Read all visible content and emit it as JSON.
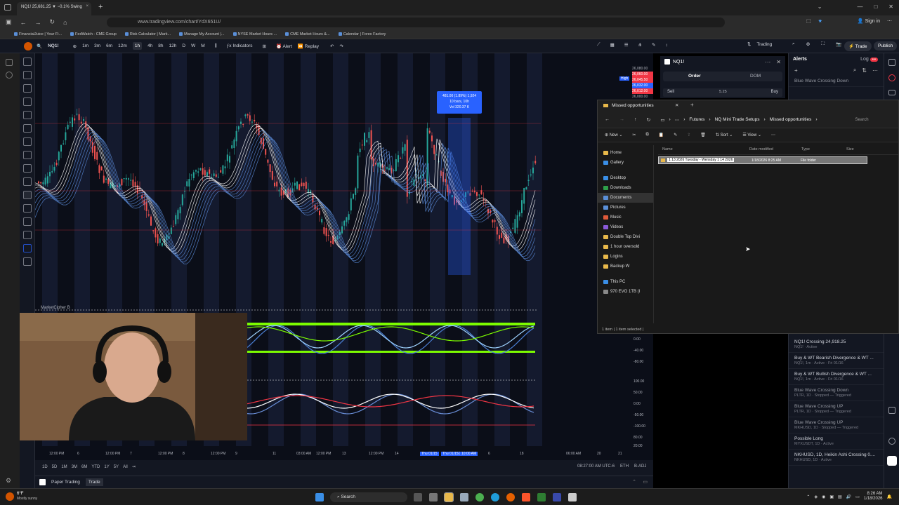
{
  "browser": {
    "tab_title": "NQ1! 25,681.25 ▼ −0.1% Swing",
    "url": "www.tradingview.com/chart/YdX651U/",
    "signin": "Sign in",
    "bookmarks": [
      "FinancialJuice | Your Fi...",
      "FedWatch - CME Group",
      "Risk Calculator | Mark...",
      "Manage My Account |...",
      "NYSE Market Hours ...",
      "CME Market Hours &...",
      "Calendar | Forex Factory"
    ]
  },
  "toolbar": {
    "symbol": "NQ1!",
    "intervals": [
      "1m",
      "3m",
      "6m",
      "12m",
      "1h",
      "4h",
      "8h",
      "12h",
      "D",
      "W",
      "M"
    ],
    "active_interval": "1h",
    "indicators": "Indicators",
    "alert": "Alert",
    "replay": "Replay",
    "trading": "Trading",
    "trade": "Trade",
    "publish": "Publish"
  },
  "chart": {
    "price_labels": [
      "26,080.00",
      "26,060.00",
      "26,045.50",
      "26,032.00",
      "26,012.00",
      "26,000.00"
    ],
    "high_label": "High",
    "tooltip": {
      "line1": "481.00 (1.89%) 1,924",
      "line2": "10 bars, 10h",
      "line3": "Vol 320.37 K"
    },
    "oscillator_label": "MarketCipher B",
    "osc_levels_1": [
      "0.00",
      "-40.00",
      "-80.00"
    ],
    "osc_levels_2": [
      "100.00",
      "50.00",
      "0.00",
      "-50.00",
      "-100.00"
    ],
    "osc_levels_3": [
      "80.00",
      "20.00"
    ],
    "time_labels": [
      "12:00 PM",
      "6",
      "12:00 PM",
      "7",
      "12:00 PM",
      "8",
      "12:00 PM",
      "9",
      "11",
      "03:00 AM",
      "12:00 PM",
      "13",
      "12:00 PM",
      "14",
      "Thu 01/15",
      "Thu 01/15/2026",
      "10:00 AM",
      "6",
      "18",
      "06:00 AM",
      "20",
      "21"
    ],
    "ranges": [
      "1D",
      "5D",
      "1M",
      "3M",
      "6M",
      "YTD",
      "1Y",
      "5Y",
      "All"
    ],
    "clock": "08:27:00 AM UTC-6",
    "eth": "ETH",
    "adj": "B-ADJ",
    "bottom_tabs": [
      "Paper Trading",
      "Trade"
    ]
  },
  "order_panel": {
    "symbol": "NQ1!",
    "tabs": [
      "Order",
      "DOM"
    ],
    "sell": "Sell",
    "spread": "5.25",
    "buy": "Buy"
  },
  "alerts": {
    "title": "Alerts",
    "log": "Log",
    "top_item": "Blue Wave Crossing Down",
    "items": [
      {
        "title": "NQ1! Crossing 24,918.25",
        "sub": "NQ1! · Active",
        "dim": false
      },
      {
        "title": "Buy & WT Bearish Divergence & WT ...",
        "sub": "NQ1!, 1m · Active · Fri 01/16",
        "dim": false
      },
      {
        "title": "Buy & WT Bullish Divergence & WT ...",
        "sub": "NQ1!, 1m · Active · Fri 01/16",
        "dim": false
      },
      {
        "title": "Blue Wave Crossing Down",
        "sub": "PLTR, 1D · Stopped — Triggered",
        "dim": true
      },
      {
        "title": "Blue Wave Crossing UP",
        "sub": "PLTR, 1D · Stopped — Triggered",
        "dim": true
      },
      {
        "title": "Blue Wave Crossing UP",
        "sub": "MKHUSD, 1D · Stopped — Triggered",
        "dim": true
      },
      {
        "title": "Possible Long",
        "sub": "MYXUSDT, 1D · Active",
        "dim": false
      },
      {
        "title": "NKHUSD, 1D, Heikin Ashi Crossing 0....",
        "sub": "NKHUSD, 1D · Active",
        "dim": false
      }
    ]
  },
  "explorer": {
    "title": "Missed opportunities",
    "breadcrumb": [
      "Futures",
      "NQ Mini Trade Setups",
      "Missed opportunities"
    ],
    "search": "Search",
    "tool_new": "New",
    "tool_sort": "Sort",
    "tool_view": "View",
    "cols": [
      "Name",
      "Date modified",
      "Type",
      "Size"
    ],
    "row": {
      "name": "1 13 2026 Tuesday - Wensday 1 14 2026",
      "date": "1/18/2026 8:25 AM",
      "type": "File folder"
    },
    "nav": [
      "Home",
      "Gallery",
      "Desktop",
      "Downloads",
      "Documents",
      "Pictures",
      "Music",
      "Videos",
      "Double Top Divi",
      "1 hour oversold",
      "Logins",
      "Backup W",
      "This PC",
      "970 EVO 1TB (I"
    ],
    "status": "1 item  |  1 item selected  |"
  },
  "taskbar": {
    "weather_temp": "6°F",
    "weather_desc": "Mostly sunny",
    "search": "Search",
    "time": "8:26 AM",
    "date": "1/18/2026"
  }
}
